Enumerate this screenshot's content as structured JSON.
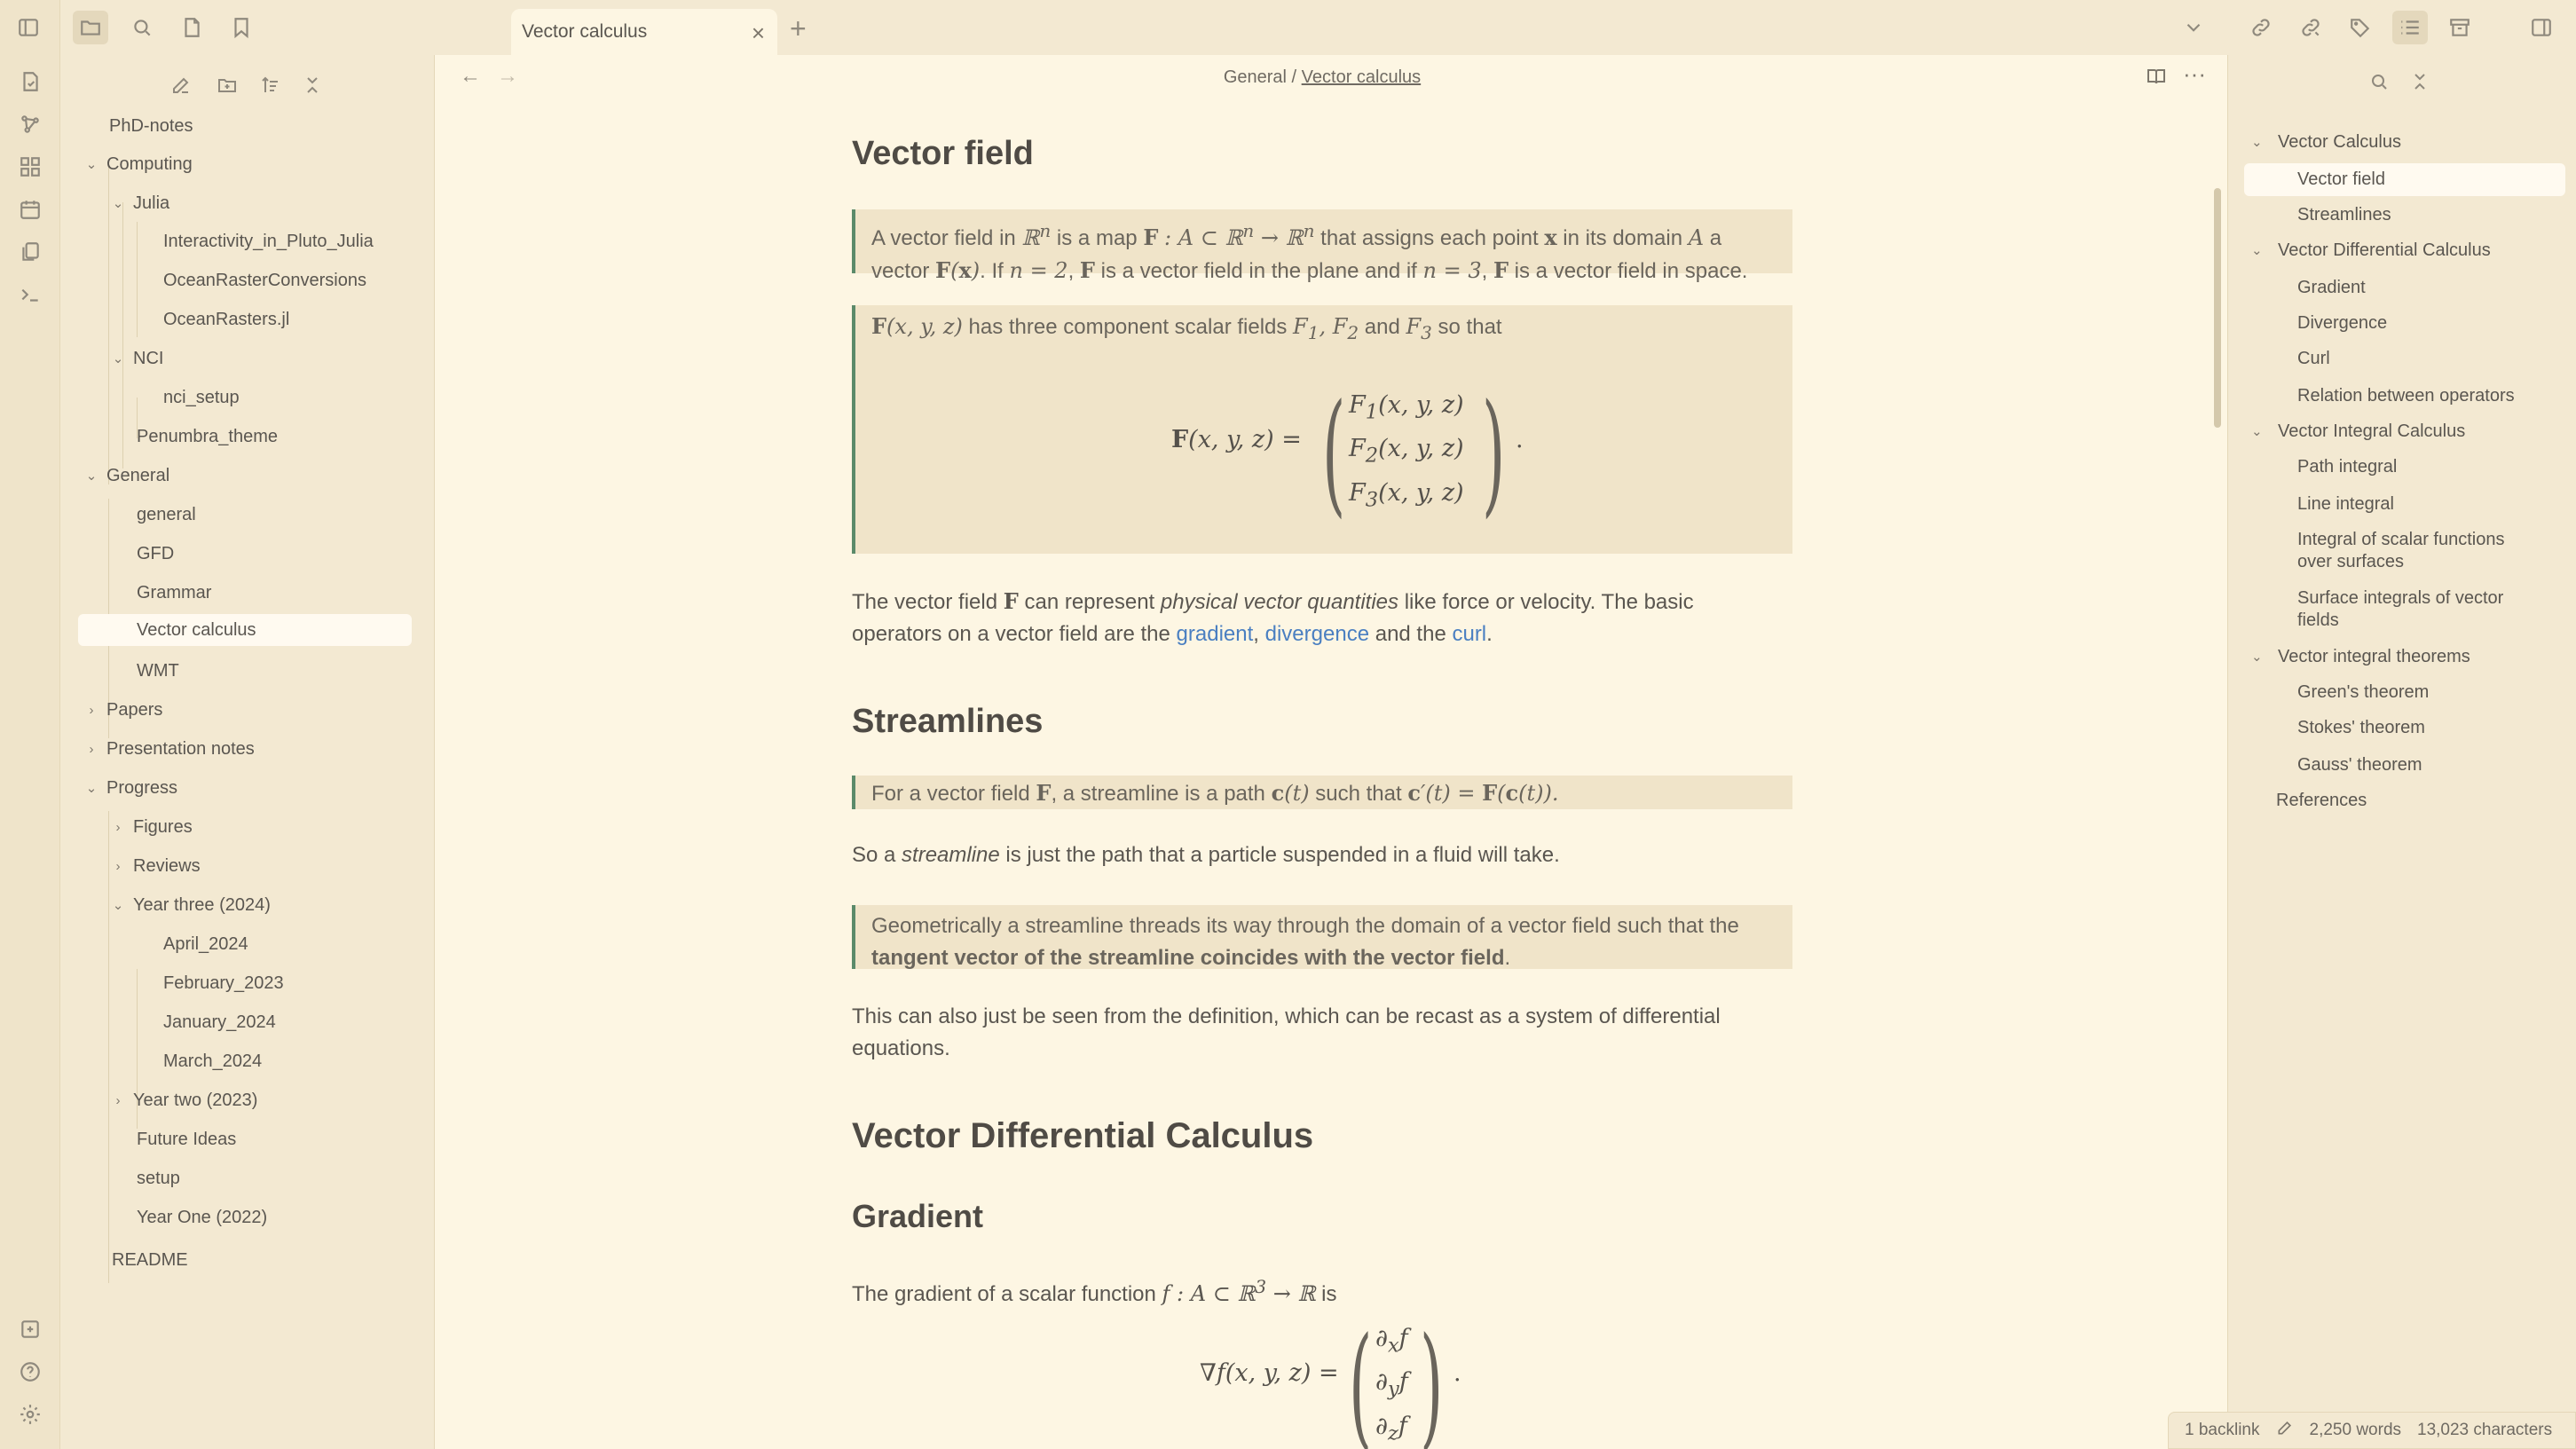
{
  "tab": {
    "title": "Vector calculus"
  },
  "breadcrumb": {
    "parent": "General",
    "separator": "/",
    "current": "Vector calculus"
  },
  "sidebar": {
    "vault": "PhD-notes",
    "items": [
      {
        "label": "Computing",
        "chevron": "down"
      },
      {
        "label": "Julia",
        "chevron": "down"
      },
      {
        "label": "Interactivity_in_Pluto_Julia"
      },
      {
        "label": "OceanRasterConversions"
      },
      {
        "label": "OceanRasters.jl"
      },
      {
        "label": "NCI",
        "chevron": "down"
      },
      {
        "label": "nci_setup"
      },
      {
        "label": "Penumbra_theme"
      },
      {
        "label": "General",
        "chevron": "down"
      },
      {
        "label": "general"
      },
      {
        "label": "GFD"
      },
      {
        "label": "Grammar"
      },
      {
        "label": "Vector calculus"
      },
      {
        "label": "WMT"
      },
      {
        "label": "Papers",
        "chevron": "right"
      },
      {
        "label": "Presentation notes",
        "chevron": "right"
      },
      {
        "label": "Progress",
        "chevron": "down"
      },
      {
        "label": "Figures",
        "chevron": "right"
      },
      {
        "label": "Reviews",
        "chevron": "right"
      },
      {
        "label": "Year three (2024)",
        "chevron": "down"
      },
      {
        "label": "April_2024"
      },
      {
        "label": "February_2023"
      },
      {
        "label": "January_2024"
      },
      {
        "label": "March_2024"
      },
      {
        "label": "Year two (2023)",
        "chevron": "right"
      },
      {
        "label": "Future Ideas"
      },
      {
        "label": "setup"
      },
      {
        "label": "Year One (2022)"
      },
      {
        "label": "README"
      }
    ]
  },
  "doc": {
    "h_vector_field": "Vector field",
    "h_streamlines": "Streamlines",
    "h_vdc": "Vector Differential Calculus",
    "h_gradient": "Gradient",
    "c1_a": "A vector field in ",
    "c1_b": " is a map ",
    "c1_c": " that assigns each point ",
    "c1_d": " in its domain ",
    "c1_e": " a",
    "c1_f": "vector ",
    "c1_g": ". If ",
    "c1_h": " is a vector field in the plane and if ",
    "c1_i": " is a vector field in space.",
    "c2_a": " has three component scalar fields ",
    "c2_b": " and ",
    "c2_c": " so that",
    "p1_a": "The vector field ",
    "p1_b": " can represent ",
    "p1_c": "physical vector quantities",
    "p1_d": " like force or velocity. The basic",
    "p1_e": "operators on a vector field are the ",
    "p1_link1": "gradient",
    "p1_link2": "divergence",
    "p1_f": " and the ",
    "p1_link3": "curl",
    "c3_a": "For a vector field ",
    "c3_b": ", a streamline is a path ",
    "c3_c": " such that ",
    "p2_a": "So a ",
    "p2_b": "streamline",
    "p2_c": " is just the path that a particle suspended in a fluid will take.",
    "c4_a": "Geometrically a streamline threads its way through the domain of a vector field such that the",
    "c4_b": "tangent vector of the streamline coincides with the vector field",
    "p3_a": "This can also just be seen from the definition, which can be recast as a system of differential",
    "p3_b": "equations.",
    "p4_a": "The gradient of a scalar function ",
    "p4_b": " is"
  },
  "outline": {
    "items": [
      {
        "label": "Vector Calculus",
        "chevron": "down"
      },
      {
        "label": "Vector field"
      },
      {
        "label": "Streamlines"
      },
      {
        "label": "Vector Differential Calculus",
        "chevron": "down"
      },
      {
        "label": "Gradient"
      },
      {
        "label": "Divergence"
      },
      {
        "label": "Curl"
      },
      {
        "label": "Relation between operators"
      },
      {
        "label": "Vector Integral Calculus",
        "chevron": "down"
      },
      {
        "label": "Path integral"
      },
      {
        "label": "Line integral"
      },
      {
        "label": "Integral of scalar functions over surfaces"
      },
      {
        "label": "Surface integrals of vector fields"
      },
      {
        "label": "Vector integral theorems",
        "chevron": "down"
      },
      {
        "label": "Green's theorem"
      },
      {
        "label": "Stokes' theorem"
      },
      {
        "label": "Gauss' theorem"
      },
      {
        "label": "References"
      }
    ]
  },
  "status": {
    "backlinks": "1 backlink",
    "words": "2,250 words",
    "chars": "13,023 characters"
  },
  "colors": {
    "accent": "#5b8a6a",
    "link": "#4a7fc1",
    "background": "#fdf6e3"
  }
}
